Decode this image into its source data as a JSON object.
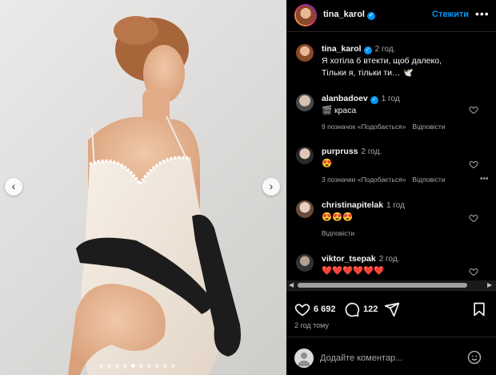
{
  "photo": {
    "alt_prev": "‹",
    "alt_next": "›",
    "slides_total": 10,
    "slide_active": 4
  },
  "post": {
    "author": "tina_karol",
    "follow_label": "Стежити",
    "more_label": "•••",
    "caption_time": "2 год.",
    "caption_line1": "Я хотіла б втекти, щоб далеко,",
    "caption_line2": "Тільки я, тільки ти… 🕊️",
    "likes": "6 692",
    "comments_count": "122",
    "posted_ago": "2 год тому",
    "add_comment_placeholder": "Додайте коментар..."
  },
  "comments": [
    {
      "user": "alanbadoev",
      "verified": true,
      "time": "1 год",
      "text": "🎬 краса",
      "meta_likes": "9 позначок «Подобається»",
      "meta_reply": "Відповісти",
      "show_dots": false
    },
    {
      "user": "purpruss",
      "verified": false,
      "time": "2 год.",
      "text": "😍",
      "meta_likes": "3 позначки «Подобається»",
      "meta_reply": "Відповісти",
      "show_dots": true
    },
    {
      "user": "christinapitelak",
      "verified": false,
      "time": "1 год",
      "text": "😍😍😍",
      "meta_likes": "",
      "meta_reply": "Відповісти",
      "show_dots": false
    },
    {
      "user": "viktor_tsepak",
      "verified": false,
      "time": "2 год.",
      "text": "❤️❤️❤️❤️❤️❤️",
      "meta_likes": "",
      "meta_reply": "",
      "show_dots": false
    }
  ],
  "icons": {
    "heart": "heart-icon",
    "comment": "comment-icon",
    "share": "share-icon",
    "bookmark": "bookmark-icon",
    "emoji": "emoji-icon",
    "verified": "verified-badge-icon"
  },
  "colors": {
    "accent": "#0095f6",
    "bg": "#000000",
    "muted": "#a8a8a8"
  }
}
